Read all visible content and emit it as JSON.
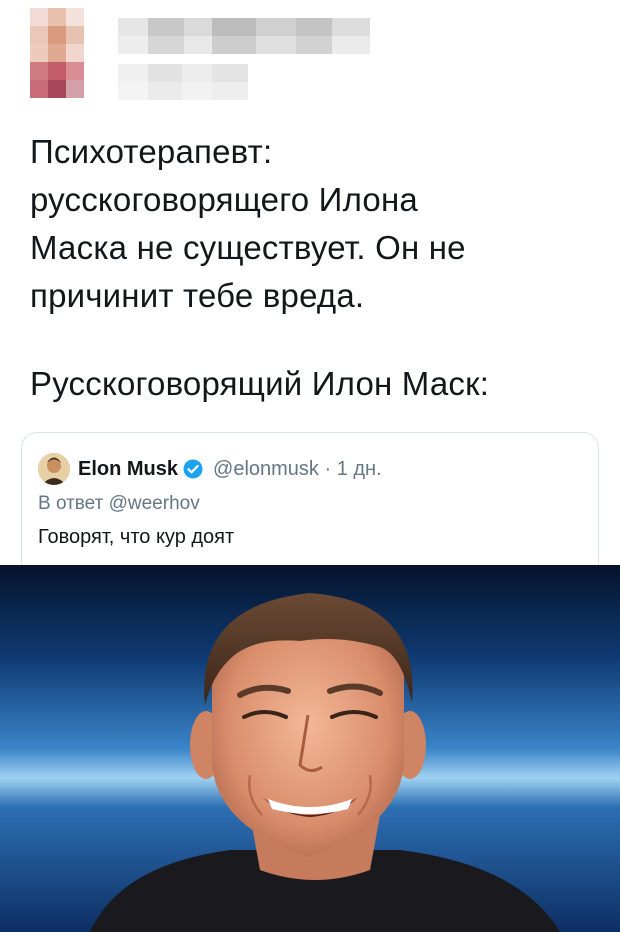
{
  "tweet": {
    "lines_block1": [
      "Психотерапевт:",
      "русскоговорящего Илона",
      "Маска не существует. Он не",
      "причинит тебе вреда."
    ],
    "line_block2": "Русскоговорящий Илон Маск:"
  },
  "quote": {
    "author_name": "Elon Musk",
    "handle_and_time": "@elonmusk · 1 дн.",
    "reply_to": "В ответ @weerhov",
    "text": "Говорят, что кур доят"
  },
  "icons": {
    "verified": "verified-badge-icon",
    "avatar": "avatar-icon"
  },
  "colors": {
    "text": "#14171a",
    "secondary_text": "#657786",
    "verified": "#1da1f2",
    "card_border": "#dde3e8",
    "photo_background": "#1c5aa0"
  }
}
